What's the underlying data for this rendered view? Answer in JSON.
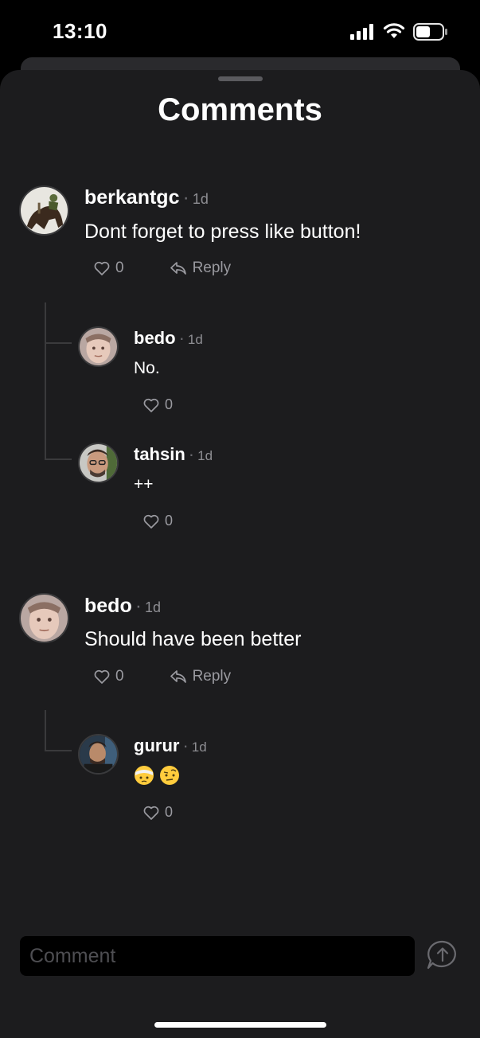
{
  "status_bar": {
    "time": "13:10"
  },
  "sheet": {
    "title": "Comments"
  },
  "comments": [
    {
      "username": "berkantgc",
      "time": "1d",
      "text": "Dont forget to press like button!",
      "likes": "0",
      "reply_label": "Reply",
      "replies": [
        {
          "username": "bedo",
          "time": "1d",
          "text": "No.",
          "likes": "0"
        },
        {
          "username": "tahsin",
          "time": "1d",
          "text": "++",
          "likes": "0"
        }
      ]
    },
    {
      "username": "bedo",
      "time": "1d",
      "text": "Should have been better",
      "likes": "0",
      "reply_label": "Reply",
      "replies": [
        {
          "username": "gurur",
          "time": "1d",
          "emoji": [
            "face-with-head-bandage",
            "face-with-raised-eyebrow"
          ],
          "likes": "0"
        }
      ]
    }
  ],
  "input": {
    "placeholder": "Comment"
  },
  "colors": {
    "background": "#1c1c1e",
    "muted": "#8e8e93",
    "thread_line": "#3a3a3c"
  }
}
